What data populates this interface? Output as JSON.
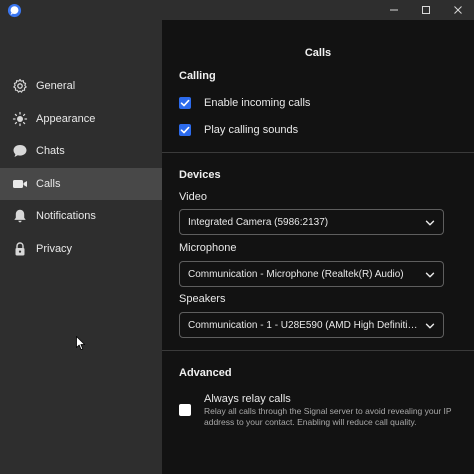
{
  "nav": {
    "items": [
      {
        "label": "General",
        "icon": "gear-icon"
      },
      {
        "label": "Appearance",
        "icon": "sun-icon"
      },
      {
        "label": "Chats",
        "icon": "chat-bubble-icon"
      },
      {
        "label": "Calls",
        "icon": "video-camera-icon",
        "active": true
      },
      {
        "label": "Notifications",
        "icon": "bell-icon"
      },
      {
        "label": "Privacy",
        "icon": "lock-icon"
      }
    ]
  },
  "page": {
    "title": "Calls"
  },
  "calling": {
    "title": "Calling",
    "enable_incoming_calls": {
      "label": "Enable incoming calls",
      "checked": true
    },
    "play_calling_sounds": {
      "label": "Play calling sounds",
      "checked": true
    }
  },
  "devices": {
    "title": "Devices",
    "video": {
      "label": "Video",
      "value": "Integrated Camera (5986:2137)"
    },
    "microphone": {
      "label": "Microphone",
      "value": "Communication - Microphone (Realtek(R) Audio)"
    },
    "speakers": {
      "label": "Speakers",
      "value": "Communication - 1 - U28E590 (AMD High Definition A..."
    }
  },
  "advanced": {
    "title": "Advanced",
    "always_relay_calls": {
      "label": "Always relay calls",
      "description": "Relay all calls through the Signal server to avoid revealing your IP address to your contact. Enabling will reduce call quality.",
      "checked": false
    }
  },
  "colors": {
    "accent": "#2c6bed",
    "sidebar_bg": "#2e2e2e",
    "active_nav_bg": "#484848",
    "main_bg": "#121212"
  }
}
